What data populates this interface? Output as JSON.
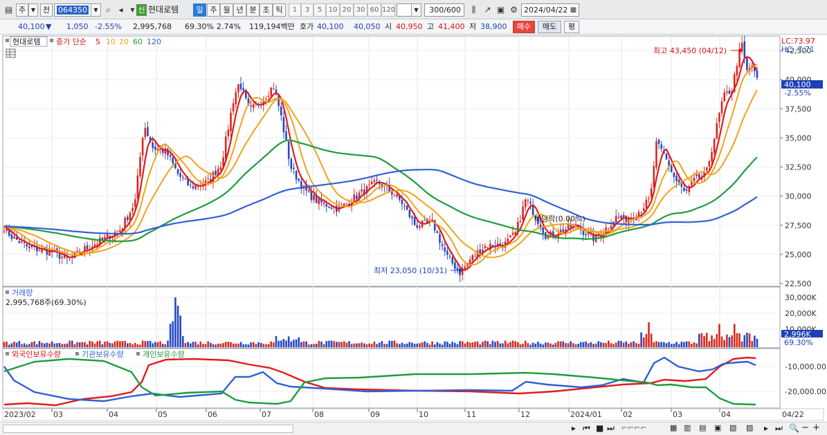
{
  "toolbar": {
    "market_label": "주",
    "prev_label": "전",
    "stock_code": "064350",
    "badge": "신",
    "stock_name": "현대로템",
    "periods": [
      "일",
      "주",
      "월",
      "년",
      "분",
      "초",
      "틱"
    ],
    "active_period": "일",
    "intervals": [
      "1",
      "3",
      "5",
      "10",
      "20",
      "30",
      "60",
      "120"
    ],
    "bar_count": "300",
    "bar_total": "/600",
    "date": "2024/04/22"
  },
  "quote": {
    "price": "40,100",
    "change": "1,050",
    "change_pct": "-2.55%",
    "volume": "2,995,768",
    "volume_ratio": "69.30%",
    "turnover": "2.74%",
    "amount": "119,194백만",
    "ask_label": "호가",
    "ask": "40,100",
    "bid": "40,050",
    "open_label": "시",
    "open": "40,950",
    "high_label": "고",
    "high": "41,400",
    "low_label": "저",
    "low": "38,900",
    "buy_label": "매수",
    "sell_label": "매도",
    "avg_label": "평"
  },
  "price_panel": {
    "stock_label": "현대로템",
    "ma_label": "종가 단순",
    "ma_periods": [
      "5",
      "10",
      "20",
      "60",
      "120"
    ],
    "ma_colors": [
      "#e01b1b",
      "#f0a21a",
      "#f0a21a",
      "#1e9c3c",
      "#2f5fd6"
    ],
    "lc": "LC:73.97",
    "hc": "HC:-7.71",
    "axis_ticks": [
      "42,500",
      "40,000",
      "37,500",
      "35,000",
      "32,500",
      "30,000",
      "27,500",
      "25,000",
      "22,500"
    ],
    "current_price": "40,100",
    "current_pct": "-2.55%",
    "high_annotation": "최고 43,450 (04/12)",
    "low_annotation": "최저 23,050 (10/31)",
    "dividend_annotation": "배당락(0.00%)"
  },
  "volume_panel": {
    "label": "거래량",
    "value": "2,995,768주(69.30%)",
    "axis_ticks": [
      "30,000K",
      "20,000K",
      "10,000K"
    ],
    "current": "2,996K",
    "current_pct": "69.30%"
  },
  "investor_panel": {
    "labels": [
      "외국인보유수량",
      "기관보유수량",
      "개인보유수량"
    ],
    "colors": [
      "#e01b1b",
      "#2f5fd6",
      "#1e9c3c"
    ],
    "axis_ticks": [
      "-10,000.00",
      "-20,000.00"
    ]
  },
  "x_axis": [
    "2023/02",
    "03",
    "04",
    "05",
    "06",
    "07",
    "08",
    "09",
    "10",
    "11",
    "12",
    "2024/01",
    "02",
    "03",
    "04",
    "04/22"
  ],
  "chart_data": {
    "type": "line",
    "title": "현대로템",
    "y_range": [
      22500,
      43450
    ],
    "key_points": [
      {
        "date": "2023-02",
        "close": 27500
      },
      {
        "date": "2023-03",
        "close": 25000
      },
      {
        "date": "2023-04",
        "close": 34000
      },
      {
        "date": "2023-05",
        "close": 31500
      },
      {
        "date": "2023-06",
        "close": 39000
      },
      {
        "date": "2023-07",
        "close": 38500
      },
      {
        "date": "2023-08",
        "close": 29500
      },
      {
        "date": "2023-09",
        "close": 31000
      },
      {
        "date": "2023-10",
        "close": 23050
      },
      {
        "date": "2023-11",
        "close": 25500
      },
      {
        "date": "2023-12",
        "close": 26500
      },
      {
        "date": "2024-01",
        "close": 26000
      },
      {
        "date": "2024-02",
        "close": 28000
      },
      {
        "date": "2024-03",
        "close": 31000
      },
      {
        "date": "2024-04-12",
        "close": 43450
      },
      {
        "date": "2024-04-22",
        "close": 40100
      }
    ]
  }
}
